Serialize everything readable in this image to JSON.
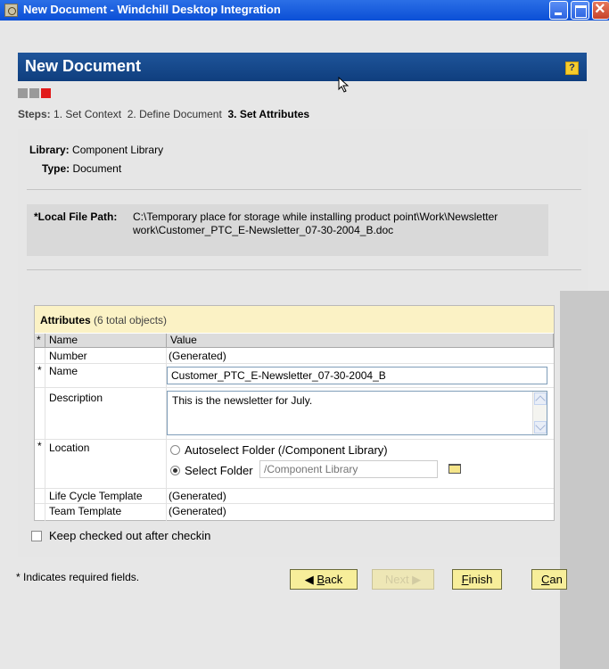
{
  "window": {
    "title": "New Document - Windchill Desktop Integration"
  },
  "header": {
    "title": "New Document",
    "help_label": "?"
  },
  "steps": {
    "label": "Steps:",
    "items": [
      "1.  Set Context",
      "2.  Define Document",
      "3.  Set Attributes"
    ]
  },
  "context": {
    "library_label": "Library:",
    "library_value": "Component Library",
    "type_label": "Type:",
    "type_value": "Document"
  },
  "local_file": {
    "label": "*Local File Path:",
    "value": "C:\\Temporary place for storage while installing product point\\Work\\Newsletter work\\Customer_PTC_E-Newsletter_07-30-2004_B.doc"
  },
  "attributes": {
    "title": "Attributes",
    "count": "(6 total objects)",
    "headers": {
      "star": "*",
      "name": "Name",
      "value": "Value"
    },
    "rows": {
      "number": {
        "name": "Number",
        "value": "(Generated)"
      },
      "name": {
        "star": "*",
        "name": "Name",
        "value": "Customer_PTC_E-Newsletter_07-30-2004_B"
      },
      "description": {
        "name": "Description",
        "value": "This is the newsletter for July."
      },
      "location": {
        "star": "*",
        "name": "Location",
        "option_auto": "Autoselect Folder (/Component Library)",
        "option_select": "Select Folder",
        "folder_placeholder": "/Component Library"
      },
      "lifecycle": {
        "name": "Life Cycle Template",
        "value": "(Generated)"
      },
      "team": {
        "name": "Team Template",
        "value": "(Generated)"
      }
    }
  },
  "keep_checked_out": {
    "label": "Keep checked out after checkin",
    "checked": false
  },
  "footer": {
    "note": "* Indicates required fields.",
    "back_label": "ack",
    "back_key": "B",
    "next_label": "Next",
    "finish_key": "F",
    "finish_label": "inish",
    "cancel_key": "C",
    "cancel_label": "an"
  }
}
